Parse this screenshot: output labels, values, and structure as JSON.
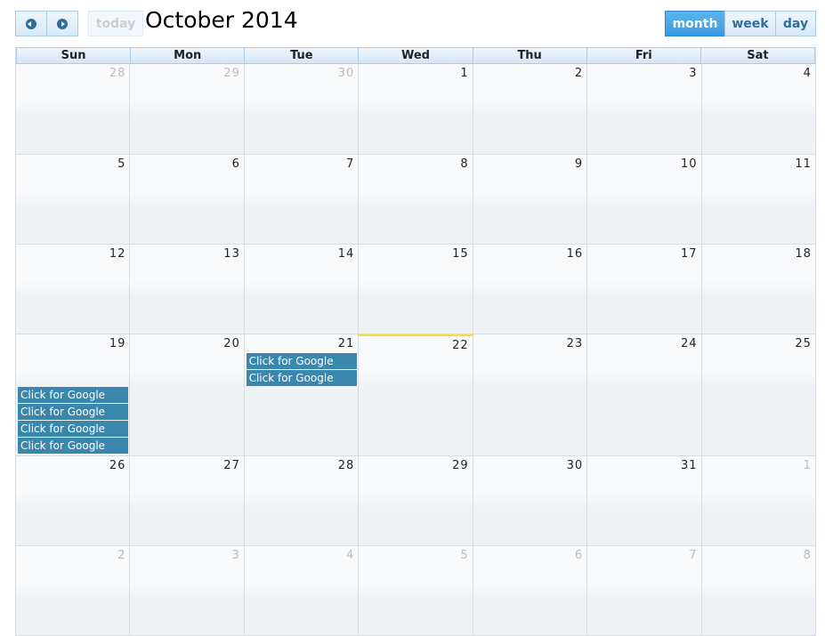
{
  "toolbar": {
    "prev_icon": "circle-triangle-left",
    "next_icon": "circle-triangle-right",
    "today_label": "today",
    "title": "October 2014",
    "views": [
      {
        "label": "month",
        "active": true
      },
      {
        "label": "week",
        "active": false
      },
      {
        "label": "day",
        "active": false
      }
    ]
  },
  "colors": {
    "event": "#3a87ad",
    "today_marker": "#fcdc3c",
    "header_border": "#a9cbe6"
  },
  "weekdays": [
    "Sun",
    "Mon",
    "Tue",
    "Wed",
    "Thu",
    "Fri",
    "Sat"
  ],
  "weeks": [
    [
      {
        "d": "28",
        "o": true
      },
      {
        "d": "29",
        "o": true
      },
      {
        "d": "30",
        "o": true
      },
      {
        "d": "1"
      },
      {
        "d": "2"
      },
      {
        "d": "3"
      },
      {
        "d": "4"
      }
    ],
    [
      {
        "d": "5"
      },
      {
        "d": "6"
      },
      {
        "d": "7"
      },
      {
        "d": "8"
      },
      {
        "d": "9"
      },
      {
        "d": "10"
      },
      {
        "d": "11"
      }
    ],
    [
      {
        "d": "12"
      },
      {
        "d": "13"
      },
      {
        "d": "14"
      },
      {
        "d": "15"
      },
      {
        "d": "16"
      },
      {
        "d": "17"
      },
      {
        "d": "18"
      }
    ],
    [
      {
        "d": "19"
      },
      {
        "d": "20"
      },
      {
        "d": "21"
      },
      {
        "d": "22",
        "today": true
      },
      {
        "d": "23"
      },
      {
        "d": "24"
      },
      {
        "d": "25"
      }
    ],
    [
      {
        "d": "26"
      },
      {
        "d": "27"
      },
      {
        "d": "28"
      },
      {
        "d": "29"
      },
      {
        "d": "30"
      },
      {
        "d": "31"
      },
      {
        "d": "1",
        "o": true
      }
    ],
    [
      {
        "d": "2",
        "o": true
      },
      {
        "d": "3",
        "o": true
      },
      {
        "d": "4",
        "o": true
      },
      {
        "d": "5",
        "o": true
      },
      {
        "d": "6",
        "o": true
      },
      {
        "d": "7",
        "o": true
      },
      {
        "d": "8",
        "o": true
      }
    ]
  ],
  "events": [
    {
      "title": "Click for Google",
      "week": 3,
      "day": 2,
      "slot": 0
    },
    {
      "title": "Click for Google",
      "week": 3,
      "day": 2,
      "slot": 1
    },
    {
      "title": "Click for Google",
      "week": 3,
      "day": 0,
      "slot": 2
    },
    {
      "title": "Click for Google",
      "week": 3,
      "day": 0,
      "slot": 3
    },
    {
      "title": "Click for Google",
      "week": 3,
      "day": 0,
      "slot": 4
    },
    {
      "title": "Click for Google",
      "week": 3,
      "day": 0,
      "slot": 5
    }
  ]
}
